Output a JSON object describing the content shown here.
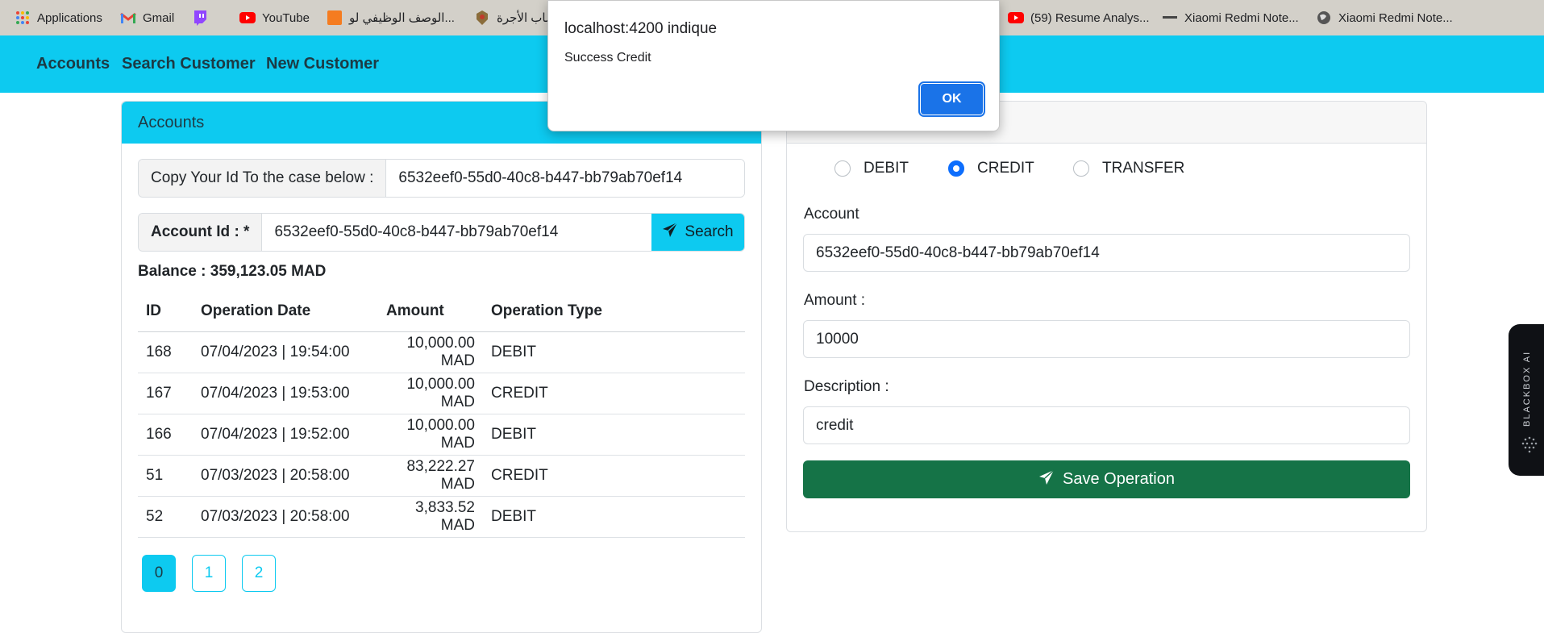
{
  "bookmarks": [
    {
      "label": "Applications",
      "icon": "apps-grid-icon"
    },
    {
      "label": "Gmail",
      "icon": "gmail-icon"
    },
    {
      "label": "",
      "icon": "twitch-icon"
    },
    {
      "label": "YouTube",
      "icon": "youtube-icon"
    },
    {
      "label": "الوصف الوظيفي لو...",
      "icon": "bayt-icon"
    },
    {
      "label": "ساب الأجرة",
      "icon": "emblem-icon"
    },
    {
      "label": "(59) Resume Analys...",
      "icon": "youtube-icon"
    },
    {
      "label": "Xiaomi Redmi Note...",
      "icon": "dash-icon"
    },
    {
      "label": "Xiaomi Redmi Note...",
      "icon": "globe-icon"
    }
  ],
  "navbar": {
    "links": [
      "Accounts",
      "Search Customer",
      "New Customer"
    ],
    "color": "#0dcaf0"
  },
  "accounts_card": {
    "title": "Accounts",
    "copy_label": "Copy Your Id To the case below :",
    "copy_value": "6532eef0-55d0-40c8-b447-bb79ab70ef14",
    "account_id_label": "Account Id : *",
    "account_id_value": "6532eef0-55d0-40c8-b447-bb79ab70ef14",
    "search_button": "Search",
    "balance": "Balance : 359,123.05 MAD",
    "table": {
      "headers": [
        "ID",
        "Operation Date",
        "Amount",
        "Operation Type"
      ],
      "rows": [
        [
          "168",
          "07/04/2023 | 19:54:00",
          "10,000.00 MAD",
          "DEBIT"
        ],
        [
          "167",
          "07/04/2023 | 19:53:00",
          "10,000.00 MAD",
          "CREDIT"
        ],
        [
          "166",
          "07/04/2023 | 19:52:00",
          "10,000.00 MAD",
          "DEBIT"
        ],
        [
          "51",
          "07/03/2023 | 20:58:00",
          "83,222.27 MAD",
          "CREDIT"
        ],
        [
          "52",
          "07/03/2023 | 20:58:00",
          "3,833.52 MAD",
          "DEBIT"
        ]
      ]
    },
    "pages": [
      "0",
      "1",
      "2"
    ],
    "active_page": "0"
  },
  "operations_card": {
    "radios": [
      {
        "label": "DEBIT",
        "checked": false
      },
      {
        "label": "CREDIT",
        "checked": true
      },
      {
        "label": "TRANSFER",
        "checked": false
      }
    ],
    "account_label": "Account",
    "account_value": "6532eef0-55d0-40c8-b447-bb79ab70ef14",
    "amount_label": "Amount :",
    "amount_value": "10000",
    "description_label": "Description :",
    "description_value": "credit",
    "save_button": "Save Operation"
  },
  "dialog": {
    "title": "localhost:4200 indique",
    "message": "Success Credit",
    "ok_label": "OK"
  },
  "side_widget": {
    "label": "BLACKBOX AI"
  },
  "colors": {
    "info": "#0dcaf0",
    "success": "#157347",
    "primary": "#1a73e8"
  }
}
